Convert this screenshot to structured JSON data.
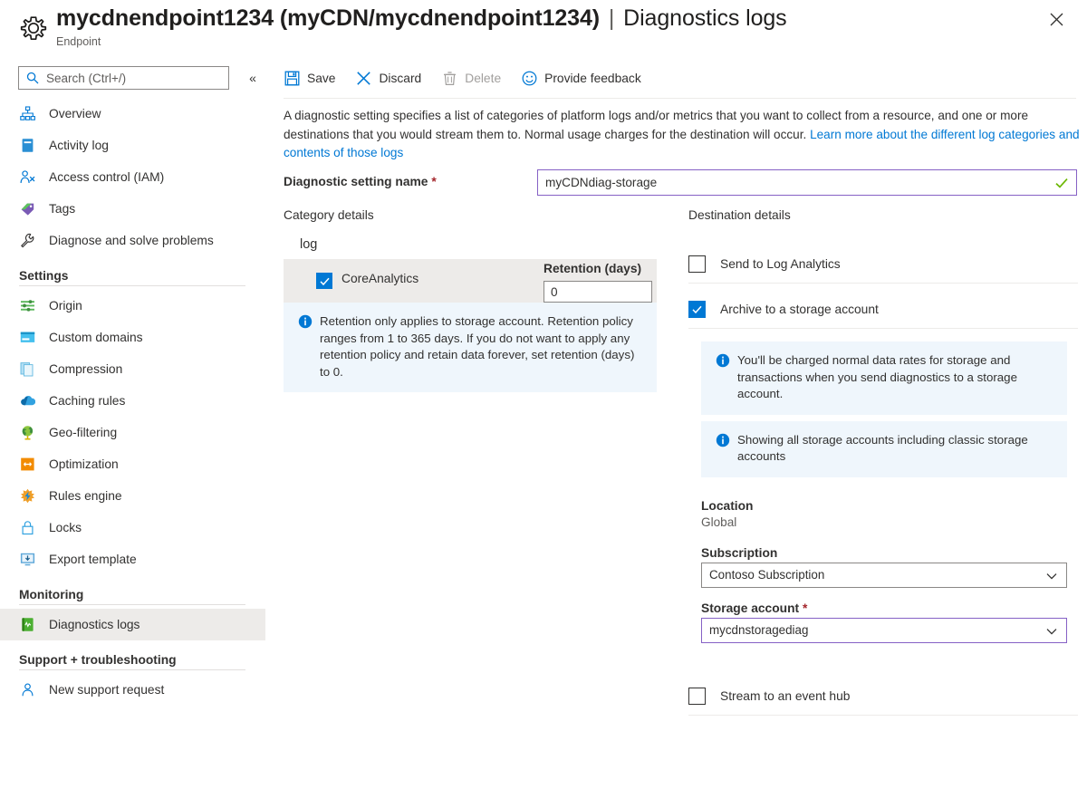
{
  "header": {
    "icon": "gear-icon",
    "resource_name": "mycdnendpoint1234",
    "resource_path": "(myCDN/mycdnendpoint1234)",
    "separator": "|",
    "page_section": "Diagnostics logs",
    "subtitle": "Endpoint",
    "close_label": "✕"
  },
  "sidebar": {
    "search": {
      "placeholder": "Search (Ctrl+/)",
      "value": "",
      "icon": "search-icon"
    },
    "collapse_label": "«",
    "items": [
      {
        "label": "Overview",
        "icon": "overview-icon",
        "selected": false
      },
      {
        "label": "Activity log",
        "icon": "activity-log-icon",
        "selected": false
      },
      {
        "label": "Access control (IAM)",
        "icon": "access-control-icon",
        "selected": false
      },
      {
        "label": "Tags",
        "icon": "tags-icon",
        "selected": false
      },
      {
        "label": "Diagnose and solve problems",
        "icon": "wrench-icon",
        "selected": false
      }
    ],
    "groups": [
      {
        "title": "Settings",
        "items": [
          {
            "label": "Origin",
            "icon": "origin-icon",
            "selected": false
          },
          {
            "label": "Custom domains",
            "icon": "custom-domains-icon",
            "selected": false
          },
          {
            "label": "Compression",
            "icon": "compression-icon",
            "selected": false
          },
          {
            "label": "Caching rules",
            "icon": "caching-rules-icon",
            "selected": false
          },
          {
            "label": "Geo-filtering",
            "icon": "geo-filtering-icon",
            "selected": false
          },
          {
            "label": "Optimization",
            "icon": "optimization-icon",
            "selected": false
          },
          {
            "label": "Rules engine",
            "icon": "rules-engine-icon",
            "selected": false
          },
          {
            "label": "Locks",
            "icon": "lock-icon",
            "selected": false
          },
          {
            "label": "Export template",
            "icon": "export-template-icon",
            "selected": false
          }
        ]
      },
      {
        "title": "Monitoring",
        "items": [
          {
            "label": "Diagnostics logs",
            "icon": "diagnostics-logs-icon",
            "selected": true
          }
        ]
      },
      {
        "title": "Support + troubleshooting",
        "items": [
          {
            "label": "New support request",
            "icon": "support-request-icon",
            "selected": false
          }
        ]
      }
    ]
  },
  "toolbar": {
    "save_label": "Save",
    "discard_label": "Discard",
    "delete_label": "Delete",
    "feedback_label": "Provide feedback"
  },
  "description": {
    "text": "A diagnostic setting specifies a list of categories of platform logs and/or metrics that you want to collect from a resource, and one or more destinations that you would stream them to. Normal usage charges for the destination will occur. ",
    "link_text": "Learn more about the different log categories and contents of those logs"
  },
  "setting_name": {
    "label": "Diagnostic setting name",
    "required_mark": "*",
    "value": "myCDNdiag-storage",
    "placeholder": "",
    "valid": true
  },
  "category_details": {
    "heading": "Category details",
    "group_title": "log",
    "retention_header": "Retention (days)",
    "rows": [
      {
        "name": "CoreAnalytics",
        "checked": true,
        "retention": "0"
      }
    ],
    "info": "Retention only applies to storage account. Retention policy ranges from 1 to 365 days. If you do not want to apply any retention policy and retain data forever, set retention (days) to 0."
  },
  "destination_details": {
    "heading": "Destination details",
    "log_analytics": {
      "label": "Send to Log Analytics",
      "checked": false
    },
    "storage_account_toggle": {
      "label": "Archive to a storage account",
      "checked": true
    },
    "info_charges": "You'll be charged normal data rates for storage and transactions when you send diagnostics to a storage account.",
    "info_showing": "Showing all storage accounts including classic storage accounts",
    "location": {
      "label": "Location",
      "value": "Global"
    },
    "subscription": {
      "label": "Subscription",
      "value": "Contoso Subscription"
    },
    "storage_account": {
      "label": "Storage account",
      "required_mark": "*",
      "value": "mycdnstoragediag"
    },
    "event_hub": {
      "label": "Stream to an event hub",
      "checked": false
    }
  },
  "colors": {
    "accent_blue": "#0078d4",
    "accent_purple": "#8661c5",
    "required_red": "#a4262c",
    "valid_green": "#6bb700",
    "info_bg": "#eff6fc",
    "selected_bg": "#edebe9"
  }
}
